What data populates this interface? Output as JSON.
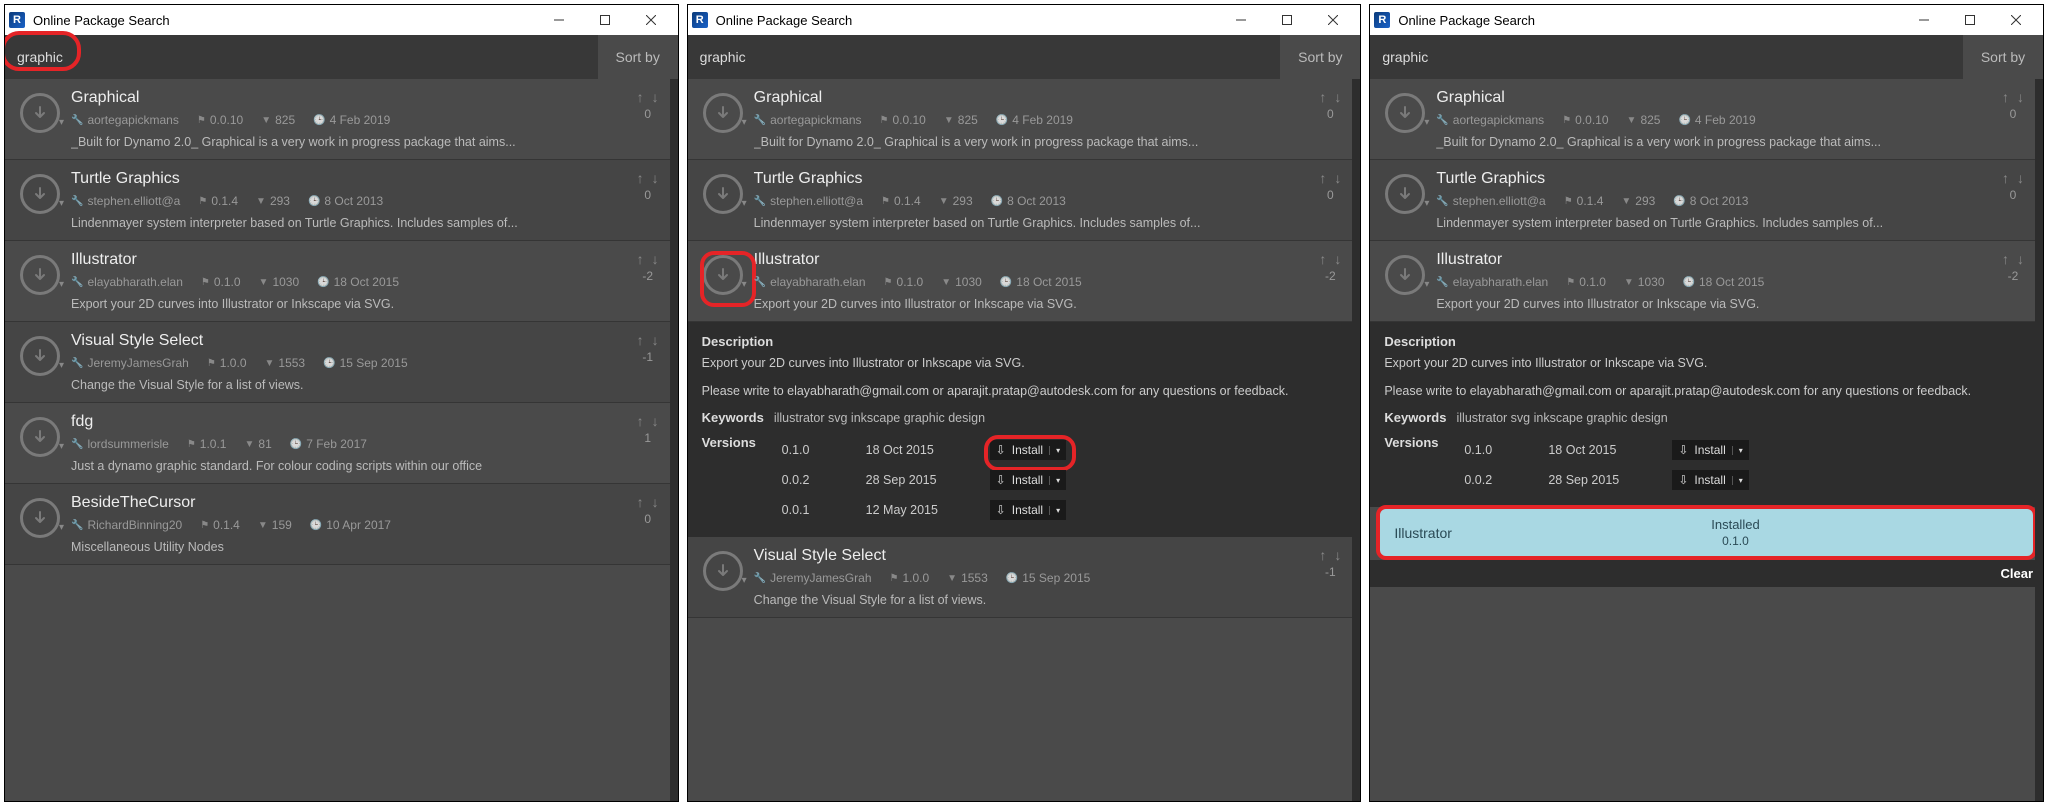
{
  "windowTitle": "Online Package Search",
  "searchTerm": "graphic",
  "sortLabel": "Sort by",
  "packages": [
    {
      "title": "Graphical",
      "author": "aortegapickmans",
      "version": "0.0.10",
      "downloads": "825",
      "date": "4 Feb 2019",
      "score": "0",
      "desc": "_Built for Dynamo 2.0_ Graphical is a very work in progress package that aims..."
    },
    {
      "title": "Turtle Graphics",
      "author": "stephen.elliott@a",
      "version": "0.1.4",
      "downloads": "293",
      "date": "8 Oct 2013",
      "score": "0",
      "desc": "Lindenmayer system interpreter based on Turtle Graphics. Includes samples of..."
    },
    {
      "title": "Illustrator",
      "author": "elayabharath.elan",
      "version": "0.1.0",
      "downloads": "1030",
      "date": "18 Oct 2015",
      "score": "-2",
      "desc": "Export your 2D curves into Illustrator or Inkscape via SVG."
    },
    {
      "title": "Visual Style Select",
      "author": "JeremyJamesGrah",
      "version": "1.0.0",
      "downloads": "1553",
      "date": "15 Sep 2015",
      "score": "-1",
      "desc": "Change the Visual Style for a list of views."
    },
    {
      "title": "fdg",
      "author": "lordsummerisle",
      "version": "1.0.1",
      "downloads": "81",
      "date": "7 Feb 2017",
      "score": "1",
      "desc": "Just a dynamo graphic standard. For colour coding scripts within our office"
    },
    {
      "title": "BesideTheCursor",
      "author": "RichardBinning20",
      "version": "0.1.4",
      "downloads": "159",
      "date": "10 Apr 2017",
      "score": "0",
      "desc": "Miscellaneous Utility Nodes"
    }
  ],
  "detail": {
    "heading": "Description",
    "p1": "Export your 2D curves into Illustrator or Inkscape via SVG.",
    "p2": "Please write to elayabharath@gmail.com or aparajit.pratap@autodesk.com for any questions or feedback.",
    "kwLabel": "Keywords",
    "keywords": "illustrator svg inkscape graphic design",
    "verLabel": "Versions",
    "versions": [
      {
        "v": "0.1.0",
        "d": "18 Oct 2015"
      },
      {
        "v": "0.0.2",
        "d": "28 Sep 2015"
      },
      {
        "v": "0.0.1",
        "d": "12 May 2015"
      }
    ],
    "installLabel": "Install"
  },
  "toast": {
    "name": "Illustrator",
    "status": "Installed",
    "version": "0.1.0"
  },
  "clearLabel": "Clear"
}
